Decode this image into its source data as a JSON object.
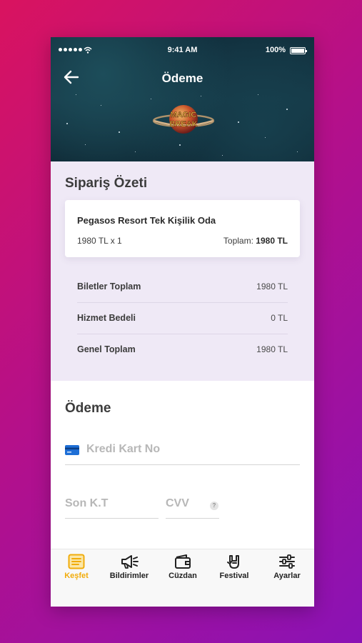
{
  "status_bar": {
    "time": "9:41 AM",
    "battery": "100%"
  },
  "header": {
    "title": "Ödeme",
    "logo_text_1": "MAGIC",
    "logo_text_2": "BREAK"
  },
  "summary": {
    "heading": "Sipariş Özeti",
    "item": {
      "name": "Pegasos Resort Tek Kişilik Oda",
      "qty": "1980 TL x 1",
      "total_label": "Toplam:",
      "total_value": "1980 TL"
    },
    "rows": [
      {
        "label": "Biletler Toplam",
        "value": "1980 TL"
      },
      {
        "label": "Hizmet Bedeli",
        "value": "0 TL"
      },
      {
        "label": "Genel Toplam",
        "value": "1980 TL"
      }
    ]
  },
  "payment": {
    "heading": "Ödeme",
    "card_number_placeholder": "Kredi Kart No",
    "expiry_placeholder": "Son K.T",
    "cvv_placeholder": "CVV",
    "cvv_help": "?"
  },
  "tabs": [
    {
      "label": "Keşfet",
      "icon": "list-icon",
      "active": true
    },
    {
      "label": "Bildirimler",
      "icon": "megaphone-icon",
      "active": false
    },
    {
      "label": "Cüzdan",
      "icon": "wallet-icon",
      "active": false
    },
    {
      "label": "Festival",
      "icon": "rock-hand-icon",
      "active": false
    },
    {
      "label": "Ayarlar",
      "icon": "sliders-icon",
      "active": false
    }
  ],
  "colors": {
    "accent": "#f1ac0b",
    "summary_bg": "#efe9f6",
    "card_icon": "#1e6fd6"
  }
}
